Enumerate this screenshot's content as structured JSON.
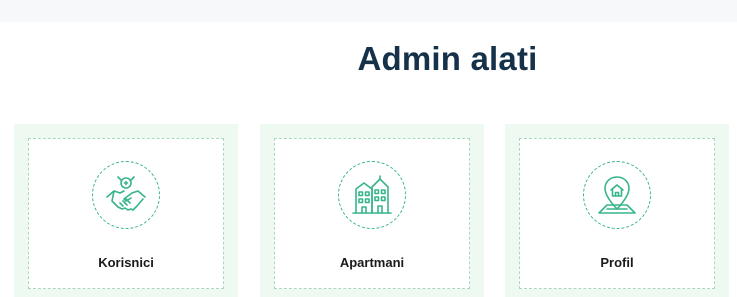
{
  "page": {
    "title": "Admin alati"
  },
  "cards": [
    {
      "label": "Korisnici",
      "icon": "handshake-icon"
    },
    {
      "label": "Apartmani",
      "icon": "building-icon"
    },
    {
      "label": "Profil",
      "icon": "location-house-icon"
    }
  ],
  "colors": {
    "title": "#16324a",
    "card_background": "#edf9f1",
    "accent": "#37b58a"
  }
}
